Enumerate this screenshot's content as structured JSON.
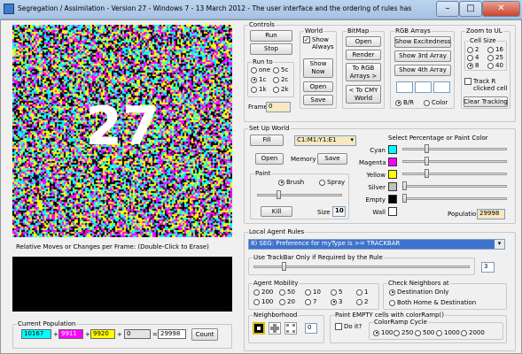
{
  "window": {
    "title": "Segregation / Assimilation - Version 27 - Windows 7 - 13 March 2012 - The user interface and the ordering of rules has been simplified...",
    "minimize": "–",
    "maximize": "□",
    "close": "✕"
  },
  "overlay_number": "27",
  "relative_moves_label": "Relative Moves or Changes per Frame: (Double-Click to Erase)",
  "population": {
    "label": "Current Population",
    "cyan": "10167",
    "magenta": "9911",
    "yellow": "9920",
    "empty": "0",
    "total": "29998",
    "sep_plus": "+",
    "sep_eq": "=",
    "count_button": "Count"
  },
  "controls": {
    "label": "Controls",
    "run": "Run",
    "stop": "Stop",
    "run_to": {
      "label": "Run to",
      "options": [
        "one",
        "5c",
        "1c",
        "2c",
        "1k",
        "2k"
      ],
      "selected": "1c"
    },
    "frame_label": "Frame",
    "frame_value": "0",
    "world": {
      "label": "World",
      "show_always": "Show Always",
      "show_now": "Show Now",
      "open": "Open",
      "save": "Save"
    },
    "bitmap": {
      "label": "BitMap",
      "open": "Open",
      "render": "Render",
      "to_rgb": "To RGB Arrays >",
      "to_cmy": "< To CMY World"
    },
    "rgb": {
      "label": "RGB Arrays",
      "show_excitedness": "Show Excitedness",
      "show_3rd": "Show 3rd Array",
      "show_4th": "Show 4th Array",
      "br": "B/R",
      "color": "Color",
      "selected": "B/R"
    },
    "zoom": {
      "label": "Zoom to UL",
      "cell_size": "Cell Size",
      "options": [
        "2",
        "16",
        "4",
        "25",
        "8",
        "40"
      ],
      "selected": "8",
      "track_r": "Track R clicked cell",
      "clear_tracking": "Clear Tracking"
    }
  },
  "setup": {
    "label": "Set Up World",
    "fill": "Fill",
    "range": "C1:M1:Y1:E1",
    "open": "Open",
    "memory": "Memory",
    "save": "Save",
    "paint": {
      "label": "Paint",
      "brush": "Brush",
      "spray": "Spray",
      "selected": "Brush",
      "kill": "Kill",
      "size_label": "Size",
      "size_value": "10"
    },
    "select_label": "Select Percentage or Paint Color",
    "colors": [
      {
        "name": "Cyan",
        "hex": "#00ffff",
        "pos": 0.22
      },
      {
        "name": "Magenta",
        "hex": "#ff00ff",
        "pos": 0.22
      },
      {
        "name": "Yellow",
        "hex": "#ffff00",
        "pos": 0.22
      },
      {
        "name": "Silver",
        "hex": "#c0c0c0",
        "pos": 0.0
      },
      {
        "name": "Empty",
        "hex": "#000000",
        "pos": 0.0
      },
      {
        "name": "Wall",
        "hex": "#ffffff",
        "pos": null
      }
    ],
    "population_label": "Population",
    "population_value": "29998"
  },
  "rules": {
    "label": "Local Agent Rules",
    "selected": "8) SEG: Preference for myType is >= TRACKBAR",
    "trackbar_label": "Use TrackBar Only if Required by the Rule",
    "trackbar_value": "3",
    "mobility": {
      "label": "Agent Mobility",
      "options": [
        "200",
        "50",
        "10",
        "5",
        "1",
        "100",
        "20",
        "7",
        "3",
        "2"
      ],
      "selected": "3"
    },
    "neighbors": {
      "label": "Check Neighbors at",
      "destination_only": "Destination Only",
      "both": "Both Home & Destination",
      "selected": "destination_only"
    },
    "neighborhood": {
      "label": "Neighborhood",
      "value": "0"
    },
    "paint_empty": {
      "label": "Paint EMPTY cells with colorRamp()",
      "do_it": "Do it?",
      "ramp_label": "ColorRamp Cycle",
      "options": [
        "100",
        "250",
        "500",
        "1000",
        "2000"
      ],
      "selected": "100"
    }
  }
}
